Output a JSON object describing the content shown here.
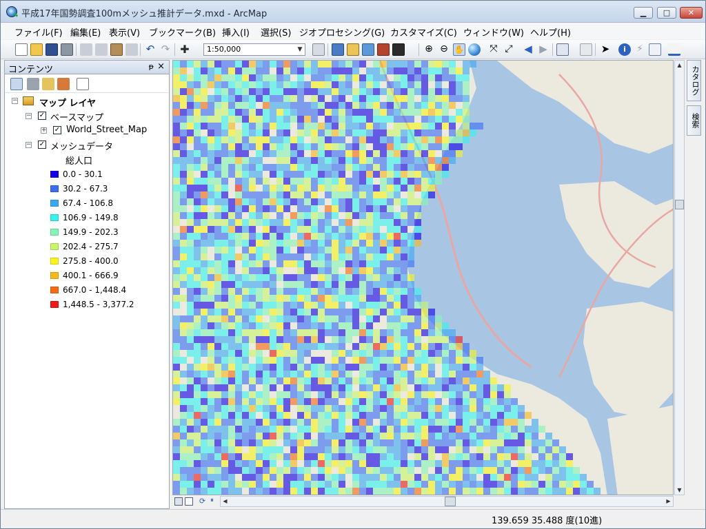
{
  "window": {
    "title": "平成17年国勢調査100mメッシュ推計データ.mxd - ArcMap",
    "minimize": "▁",
    "maximize": "□",
    "close": "✕"
  },
  "menubar": {
    "items": [
      "ファイル(F)",
      "編集(E)",
      "表示(V)",
      "ブックマーク(B)",
      "挿入(I)",
      "選択(S)",
      "ジオプロセシング(G)",
      "カスタマイズ(C)",
      "ウィンドウ(W)",
      "ヘルプ(H)"
    ]
  },
  "toolbar": {
    "scale": "1:50,000"
  },
  "toc": {
    "title": "コンテンツ",
    "pin": "ᵽ",
    "close": "×",
    "root": "マップ レイヤ",
    "basemap_group": "ベースマップ",
    "basemap_layer": "World_Street_Map",
    "mesh_group": "メッシュデータ",
    "field": "総人口",
    "legend": [
      {
        "label": "0.0 - 30.1",
        "color": "#1400e6"
      },
      {
        "label": "30.2 - 67.3",
        "color": "#3a6cf5"
      },
      {
        "label": "67.4 - 106.8",
        "color": "#3aa8f3"
      },
      {
        "label": "106.9 - 149.8",
        "color": "#35f2f0"
      },
      {
        "label": "149.9 - 202.3",
        "color": "#84f5b4"
      },
      {
        "label": "202.4 - 275.7",
        "color": "#c8f56c"
      },
      {
        "label": "275.8 - 400.0",
        "color": "#f7f41e"
      },
      {
        "label": "400.1 - 666.9",
        "color": "#f7b81b"
      },
      {
        "label": "667.0 - 1,448.4",
        "color": "#f56a14"
      },
      {
        "label": "1,448.5 - 3,377.2",
        "color": "#f01a17"
      }
    ]
  },
  "dock": {
    "catalog": "カタログ",
    "search": "検索"
  },
  "status": {
    "coordinates": "139.659  35.488 度(10進)"
  },
  "map": {
    "water_color": "#a8c6e4",
    "land_color": "#ece9df",
    "road_color": "#e8a7a2"
  }
}
